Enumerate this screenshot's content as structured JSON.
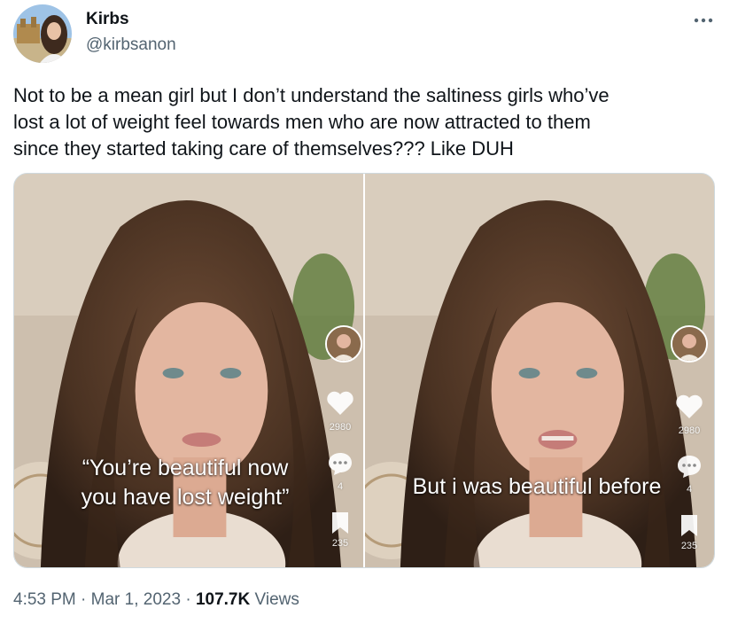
{
  "author": {
    "name": "Kirbs",
    "handle": "@kirbsanon",
    "avatar_icon": "profile-photo"
  },
  "menu": {
    "icon": "more-horizontal-icon"
  },
  "tweet": {
    "text": "Not to be a mean girl but I don’t understand the saltiness girls who’ve\nlost a lot of weight feel towards men who are now attracted to them\nsince they started taking care of themselves??? Like DUH"
  },
  "media": [
    {
      "caption": "“You’re beautiful now\nyou have lost weight”",
      "likes": "2980",
      "comments": "4",
      "saves": "235"
    },
    {
      "caption": "But i was beautiful before",
      "likes": "2980",
      "comments": "4",
      "saves": "235"
    }
  ],
  "footer": {
    "time": "4:53 PM",
    "separator": "·",
    "date": "Mar 1, 2023",
    "views_count": "107.7K",
    "views_label": "Views"
  },
  "colors": {
    "text": "#0f1419",
    "secondary": "#536471",
    "border": "#cfd9de"
  }
}
